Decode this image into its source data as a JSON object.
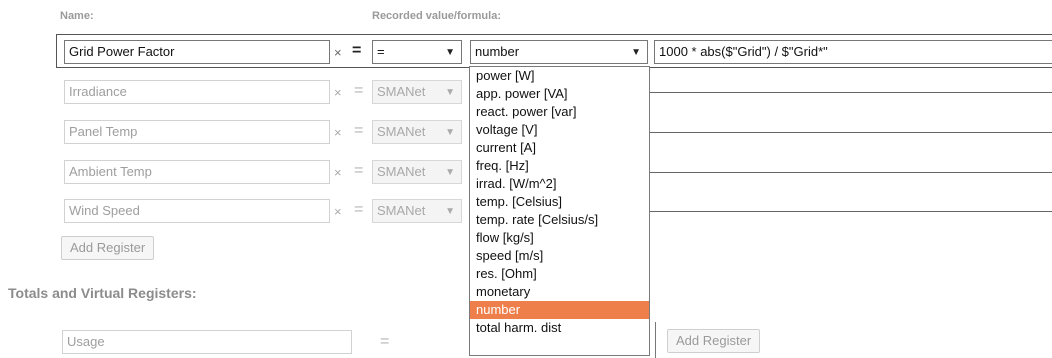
{
  "headers": {
    "name": "Name:",
    "recorded": "Recorded value/formula:"
  },
  "active_row": {
    "name": "Grid Power Factor",
    "clear": "×",
    "equals": "=",
    "operator": "=",
    "type": "number",
    "formula": "1000 * abs($\"Grid\") / $\"Grid*\""
  },
  "registers": [
    {
      "name": "Irradiance",
      "source": "SMANet"
    },
    {
      "name": "Panel Temp",
      "source": "SMANet"
    },
    {
      "name": "Ambient Temp",
      "source": "SMANet"
    },
    {
      "name": "Wind Speed",
      "source": "SMANet"
    }
  ],
  "clear_glyph": "×",
  "equals_glyph": "=",
  "arrow_glyph": "▼",
  "add_register_label": "Add Register",
  "totals_title": "Totals and Virtual Registers:",
  "totals_row": {
    "name": "Usage",
    "equals": "=",
    "add_label": "Add Register"
  },
  "dropdown_options": [
    "power [W]",
    "app. power [VA]",
    "react. power [var]",
    "voltage [V]",
    "current [A]",
    "freq. [Hz]",
    "irrad. [W/m^2]",
    "temp. [Celsius]",
    "temp. rate [Celsius/s]",
    "flow [kg/s]",
    "speed [m/s]",
    "res. [Ohm]",
    "monetary",
    "number",
    "total harm. dist"
  ],
  "dropdown_selected": "number",
  "colors": {
    "highlight": "#ee7e4a"
  }
}
